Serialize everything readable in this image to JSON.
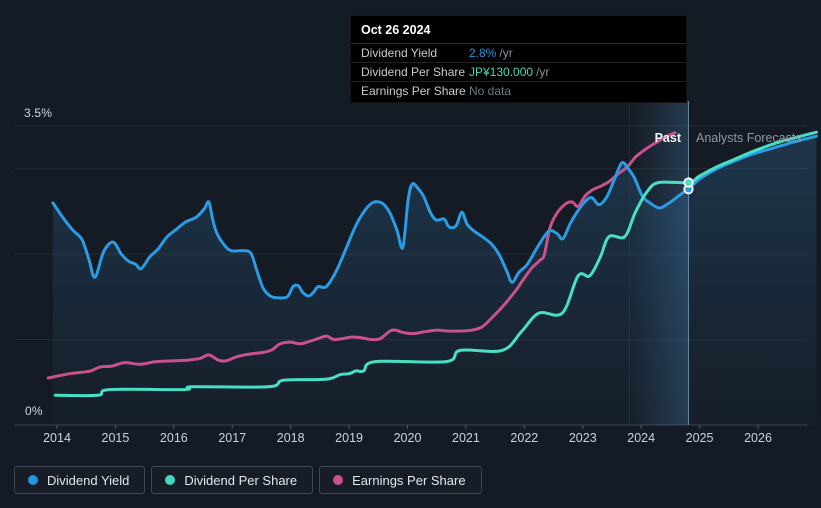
{
  "tooltip": {
    "date": "Oct 26 2024",
    "rows": [
      {
        "label": "Dividend Yield",
        "value": "2.8%",
        "suffix": "/yr",
        "value_color": "#2394df"
      },
      {
        "label": "Dividend Per Share",
        "value": "JP¥130.000",
        "suffix": "/yr",
        "value_color": "#41d9c1"
      },
      {
        "label": "Earnings Per Share",
        "value": "No data",
        "suffix": "",
        "value_color": "#6e7680"
      }
    ]
  },
  "chart": {
    "y_axis": {
      "top_label": "3.5%",
      "bottom_label": "0%"
    },
    "x_axis": {
      "years": [
        2014,
        2015,
        2016,
        2017,
        2018,
        2019,
        2020,
        2021,
        2022,
        2023,
        2024,
        2025,
        2026
      ]
    },
    "regions": {
      "past_label": "Past",
      "forecast_label": "Analysts Forecasts"
    }
  },
  "legend": [
    {
      "label": "Dividend Yield",
      "color": "#2394df"
    },
    {
      "label": "Dividend Per Share",
      "color": "#41d9c1"
    },
    {
      "label": "Earnings Per Share",
      "color": "#c9518e"
    }
  ],
  "colors": {
    "background": "#151b24",
    "dividend_yield": "#2b9ce3",
    "dividend_per_share": "#49dfc5",
    "earnings_per_share": "#c9518e",
    "past_divider": "rgba(170,205,235,0.55)",
    "gridline": "rgba(255,255,255,0.075)",
    "axis_line": "rgba(255,255,255,0.17)"
  },
  "chart_data": {
    "type": "line",
    "title": "Dividend history and forecast",
    "x_unit": "year (decimal)",
    "xlim": [
      2013.75,
      2027.05
    ],
    "ylim_percent": [
      0,
      3.5
    ],
    "gridlines_percent": [
      3.5,
      3,
      2,
      1
    ],
    "labeled_gridlines": {
      "3.5": "3.5%",
      "0": "0%"
    },
    "today": {
      "x": 2024.81,
      "date": "Oct 26 2024",
      "dividend_yield_pct": 2.8,
      "dividend_per_share_jpy": 130.0,
      "earnings_per_share": "No data"
    },
    "highlight_band_x": [
      2023.8,
      2024.81
    ],
    "legend_position": "bottom-left",
    "series": [
      {
        "name": "Dividend Yield",
        "unit": "%",
        "color": "#2b9ce3",
        "area_fill": true,
        "past": [
          [
            2013.93,
            2.6
          ],
          [
            2014.1,
            2.43
          ],
          [
            2014.27,
            2.28
          ],
          [
            2014.43,
            2.17
          ],
          [
            2014.55,
            1.93
          ],
          [
            2014.65,
            1.73
          ],
          [
            2014.8,
            2.03
          ],
          [
            2014.96,
            2.14
          ],
          [
            2015.1,
            2.0
          ],
          [
            2015.22,
            1.92
          ],
          [
            2015.35,
            1.88
          ],
          [
            2015.44,
            1.83
          ],
          [
            2015.59,
            1.97
          ],
          [
            2015.73,
            2.06
          ],
          [
            2015.88,
            2.2
          ],
          [
            2016.04,
            2.29
          ],
          [
            2016.21,
            2.38
          ],
          [
            2016.38,
            2.43
          ],
          [
            2016.52,
            2.53
          ],
          [
            2016.6,
            2.61
          ],
          [
            2016.67,
            2.39
          ],
          [
            2016.74,
            2.24
          ],
          [
            2016.86,
            2.11
          ],
          [
            2016.98,
            2.04
          ],
          [
            2017.18,
            2.04
          ],
          [
            2017.32,
            2.01
          ],
          [
            2017.42,
            1.81
          ],
          [
            2017.53,
            1.6
          ],
          [
            2017.65,
            1.51
          ],
          [
            2017.77,
            1.49
          ],
          [
            2017.94,
            1.5
          ],
          [
            2018.04,
            1.62
          ],
          [
            2018.13,
            1.63
          ],
          [
            2018.21,
            1.55
          ],
          [
            2018.31,
            1.51
          ],
          [
            2018.4,
            1.56
          ],
          [
            2018.47,
            1.62
          ],
          [
            2018.61,
            1.62
          ],
          [
            2018.78,
            1.8
          ],
          [
            2018.95,
            2.07
          ],
          [
            2019.12,
            2.34
          ],
          [
            2019.29,
            2.53
          ],
          [
            2019.43,
            2.61
          ],
          [
            2019.58,
            2.59
          ],
          [
            2019.7,
            2.48
          ],
          [
            2019.82,
            2.28
          ],
          [
            2019.92,
            2.08
          ],
          [
            2020.01,
            2.63
          ],
          [
            2020.08,
            2.82
          ],
          [
            2020.18,
            2.77
          ],
          [
            2020.28,
            2.67
          ],
          [
            2020.39,
            2.49
          ],
          [
            2020.49,
            2.4
          ],
          [
            2020.63,
            2.41
          ],
          [
            2020.71,
            2.32
          ],
          [
            2020.83,
            2.33
          ],
          [
            2020.93,
            2.49
          ],
          [
            2021.02,
            2.35
          ],
          [
            2021.14,
            2.27
          ],
          [
            2021.29,
            2.2
          ],
          [
            2021.45,
            2.11
          ],
          [
            2021.58,
            1.98
          ],
          [
            2021.7,
            1.8
          ],
          [
            2021.79,
            1.67
          ],
          [
            2021.91,
            1.79
          ],
          [
            2022.05,
            1.88
          ],
          [
            2022.24,
            2.1
          ],
          [
            2022.42,
            2.27
          ],
          [
            2022.56,
            2.24
          ],
          [
            2022.66,
            2.18
          ],
          [
            2022.78,
            2.35
          ],
          [
            2022.9,
            2.49
          ],
          [
            2023.06,
            2.63
          ],
          [
            2023.16,
            2.66
          ],
          [
            2023.28,
            2.58
          ],
          [
            2023.42,
            2.68
          ],
          [
            2023.55,
            2.89
          ],
          [
            2023.67,
            3.07
          ],
          [
            2023.78,
            3.0
          ],
          [
            2023.88,
            2.9
          ],
          [
            2024.02,
            2.68
          ],
          [
            2024.15,
            2.6
          ],
          [
            2024.31,
            2.54
          ],
          [
            2024.46,
            2.59
          ],
          [
            2024.6,
            2.66
          ],
          [
            2024.72,
            2.72
          ],
          [
            2024.81,
            2.76
          ]
        ],
        "forecast": [
          [
            2025.0,
            2.88
          ],
          [
            2025.3,
            3.0
          ],
          [
            2025.6,
            3.09
          ],
          [
            2025.9,
            3.17
          ],
          [
            2026.2,
            3.23
          ],
          [
            2026.45,
            3.28
          ],
          [
            2026.7,
            3.33
          ],
          [
            2027.0,
            3.38
          ]
        ]
      },
      {
        "name": "Dividend Per Share",
        "unit": "JPY per share (estimated; anchored to JP¥130.000 at Oct 26 2024)",
        "color": "#49dfc5",
        "scale_jpy_per_percent": 45.8,
        "past": [
          [
            2013.97,
            16
          ],
          [
            2014.7,
            16
          ],
          [
            2014.9,
            19
          ],
          [
            2016.18,
            19
          ],
          [
            2016.32,
            20.5
          ],
          [
            2017.62,
            20.5
          ],
          [
            2017.88,
            24
          ],
          [
            2018.6,
            24.5
          ],
          [
            2018.85,
            27
          ],
          [
            2019.0,
            27.5
          ],
          [
            2019.12,
            29
          ],
          [
            2019.25,
            29
          ],
          [
            2019.45,
            34
          ],
          [
            2020.66,
            34
          ],
          [
            2020.9,
            40
          ],
          [
            2021.62,
            40
          ],
          [
            2021.95,
            50
          ],
          [
            2022.25,
            60
          ],
          [
            2022.65,
            60
          ],
          [
            2022.92,
            80
          ],
          [
            2023.12,
            80
          ],
          [
            2023.3,
            90
          ],
          [
            2023.45,
            101
          ],
          [
            2023.72,
            101
          ],
          [
            2023.9,
            114
          ],
          [
            2024.1,
            125
          ],
          [
            2024.3,
            130
          ],
          [
            2024.81,
            130
          ]
        ],
        "forecast": [
          [
            2025.0,
            133.5
          ],
          [
            2025.3,
            138.5
          ],
          [
            2025.6,
            142.5
          ],
          [
            2025.9,
            146.5
          ],
          [
            2026.2,
            150
          ],
          [
            2026.45,
            152.5
          ],
          [
            2026.7,
            154.5
          ],
          [
            2027.0,
            157
          ]
        ]
      },
      {
        "name": "Earnings Per Share",
        "unit": "relative position on % axis (no value axis shown; series ends mid-2024, tooltip shows No data)",
        "color": "#c9518e",
        "past": [
          [
            2013.85,
            0.55
          ],
          [
            2014.22,
            0.6
          ],
          [
            2014.56,
            0.63
          ],
          [
            2014.74,
            0.68
          ],
          [
            2014.94,
            0.69
          ],
          [
            2015.16,
            0.73
          ],
          [
            2015.42,
            0.71
          ],
          [
            2015.68,
            0.74
          ],
          [
            2015.97,
            0.75
          ],
          [
            2016.24,
            0.76
          ],
          [
            2016.45,
            0.78
          ],
          [
            2016.6,
            0.82
          ],
          [
            2016.76,
            0.76
          ],
          [
            2016.89,
            0.75
          ],
          [
            2017.08,
            0.8
          ],
          [
            2017.3,
            0.83
          ],
          [
            2017.53,
            0.85
          ],
          [
            2017.68,
            0.88
          ],
          [
            2017.82,
            0.95
          ],
          [
            2017.99,
            0.97
          ],
          [
            2018.16,
            0.95
          ],
          [
            2018.33,
            0.98
          ],
          [
            2018.5,
            1.02
          ],
          [
            2018.62,
            1.04
          ],
          [
            2018.74,
            1.0
          ],
          [
            2018.88,
            1.01
          ],
          [
            2019.05,
            1.03
          ],
          [
            2019.22,
            1.02
          ],
          [
            2019.38,
            1.0
          ],
          [
            2019.53,
            1.01
          ],
          [
            2019.7,
            1.1
          ],
          [
            2019.8,
            1.11
          ],
          [
            2019.94,
            1.08
          ],
          [
            2020.11,
            1.07
          ],
          [
            2020.28,
            1.09
          ],
          [
            2020.49,
            1.11
          ],
          [
            2020.69,
            1.1
          ],
          [
            2020.9,
            1.1
          ],
          [
            2021.1,
            1.11
          ],
          [
            2021.28,
            1.15
          ],
          [
            2021.45,
            1.26
          ],
          [
            2021.58,
            1.35
          ],
          [
            2021.72,
            1.46
          ],
          [
            2021.86,
            1.58
          ],
          [
            2022.0,
            1.72
          ],
          [
            2022.13,
            1.84
          ],
          [
            2022.27,
            1.93
          ],
          [
            2022.34,
            1.99
          ],
          [
            2022.44,
            2.31
          ],
          [
            2022.56,
            2.48
          ],
          [
            2022.71,
            2.59
          ],
          [
            2022.82,
            2.61
          ],
          [
            2022.92,
            2.56
          ],
          [
            2023.04,
            2.68
          ],
          [
            2023.16,
            2.75
          ],
          [
            2023.29,
            2.79
          ],
          [
            2023.43,
            2.84
          ],
          [
            2023.59,
            2.93
          ],
          [
            2023.76,
            3.02
          ],
          [
            2023.91,
            3.14
          ],
          [
            2024.08,
            3.23
          ],
          [
            2024.24,
            3.3
          ],
          [
            2024.41,
            3.37
          ],
          [
            2024.58,
            3.42
          ]
        ],
        "forecast": []
      }
    ]
  }
}
